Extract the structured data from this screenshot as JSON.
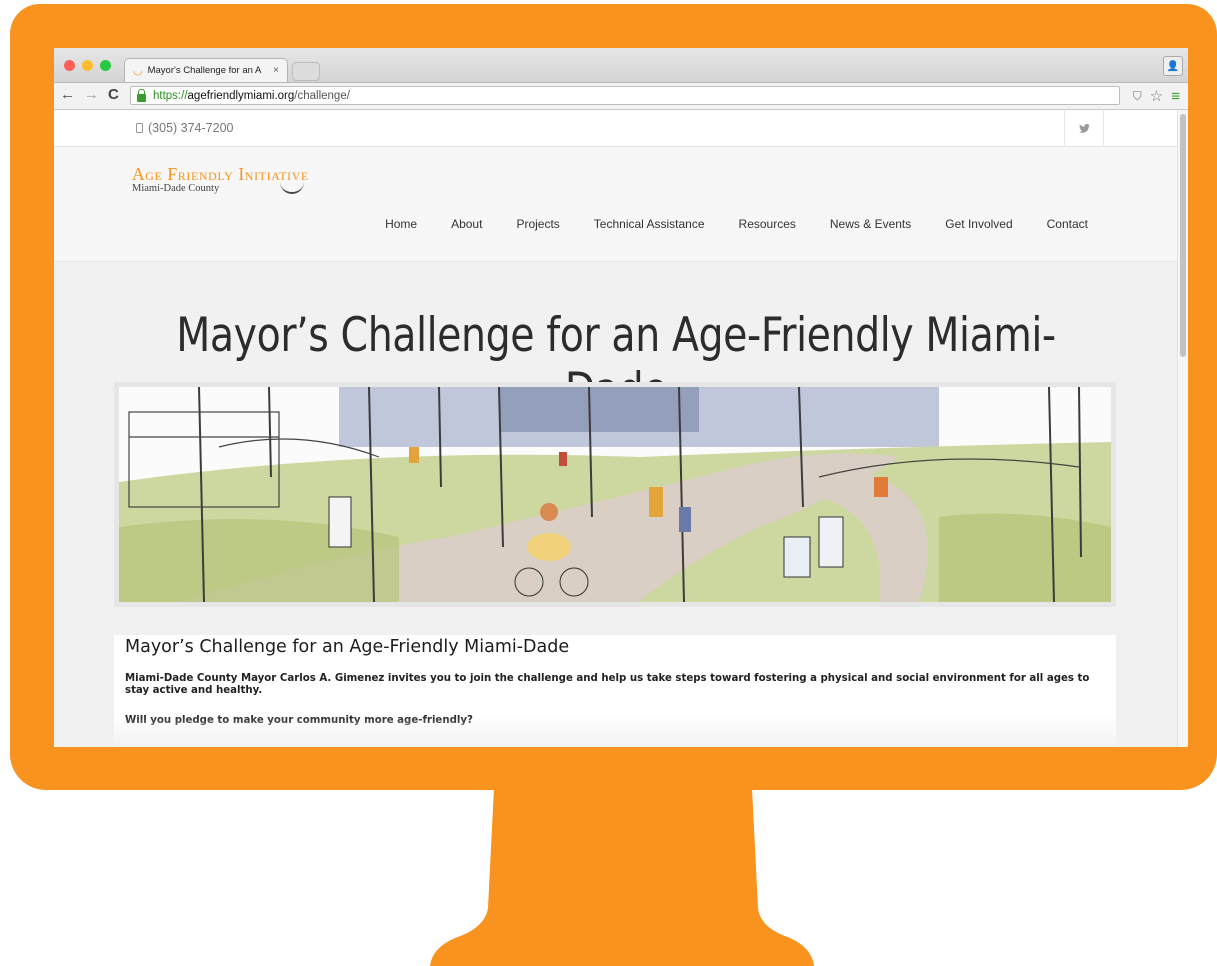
{
  "browser": {
    "tab_title": "Mayor's Challenge for an A",
    "tab_close": "×",
    "url_scheme": "https://",
    "url_host": "agefriendlymiami.org",
    "url_path": "/challenge/"
  },
  "site": {
    "phone": "(305) 374-7200",
    "logo_title": "Age Friendly Initiative",
    "logo_subtitle": "Miami-Dade County",
    "nav": [
      "Home",
      "About",
      "Projects",
      "Technical Assistance",
      "Resources",
      "News & Events",
      "Get Involved",
      "Contact"
    ]
  },
  "hero": {
    "title": "Mayor’s Challenge for an Age-Friendly Miami-Dade"
  },
  "content": {
    "heading": "Mayor’s Challenge for an Age-Friendly Miami-Dade",
    "paragraph1": "Miami-Dade County Mayor Carlos A. Gimenez invites you to join the challenge and help us take steps toward fostering a physical and social environment for all ages to stay active and healthy.",
    "paragraph2": "Will you pledge to make your community more age-friendly?"
  },
  "colors": {
    "monitor": "#f7931e",
    "link_green": "#2a8f22"
  },
  "icons": [
    "back-arrow-icon",
    "forward-arrow-icon",
    "reload-icon",
    "lock-icon",
    "shield-icon",
    "star-icon",
    "menu-icon",
    "phone-icon",
    "twitter-icon",
    "profile-icon"
  ]
}
